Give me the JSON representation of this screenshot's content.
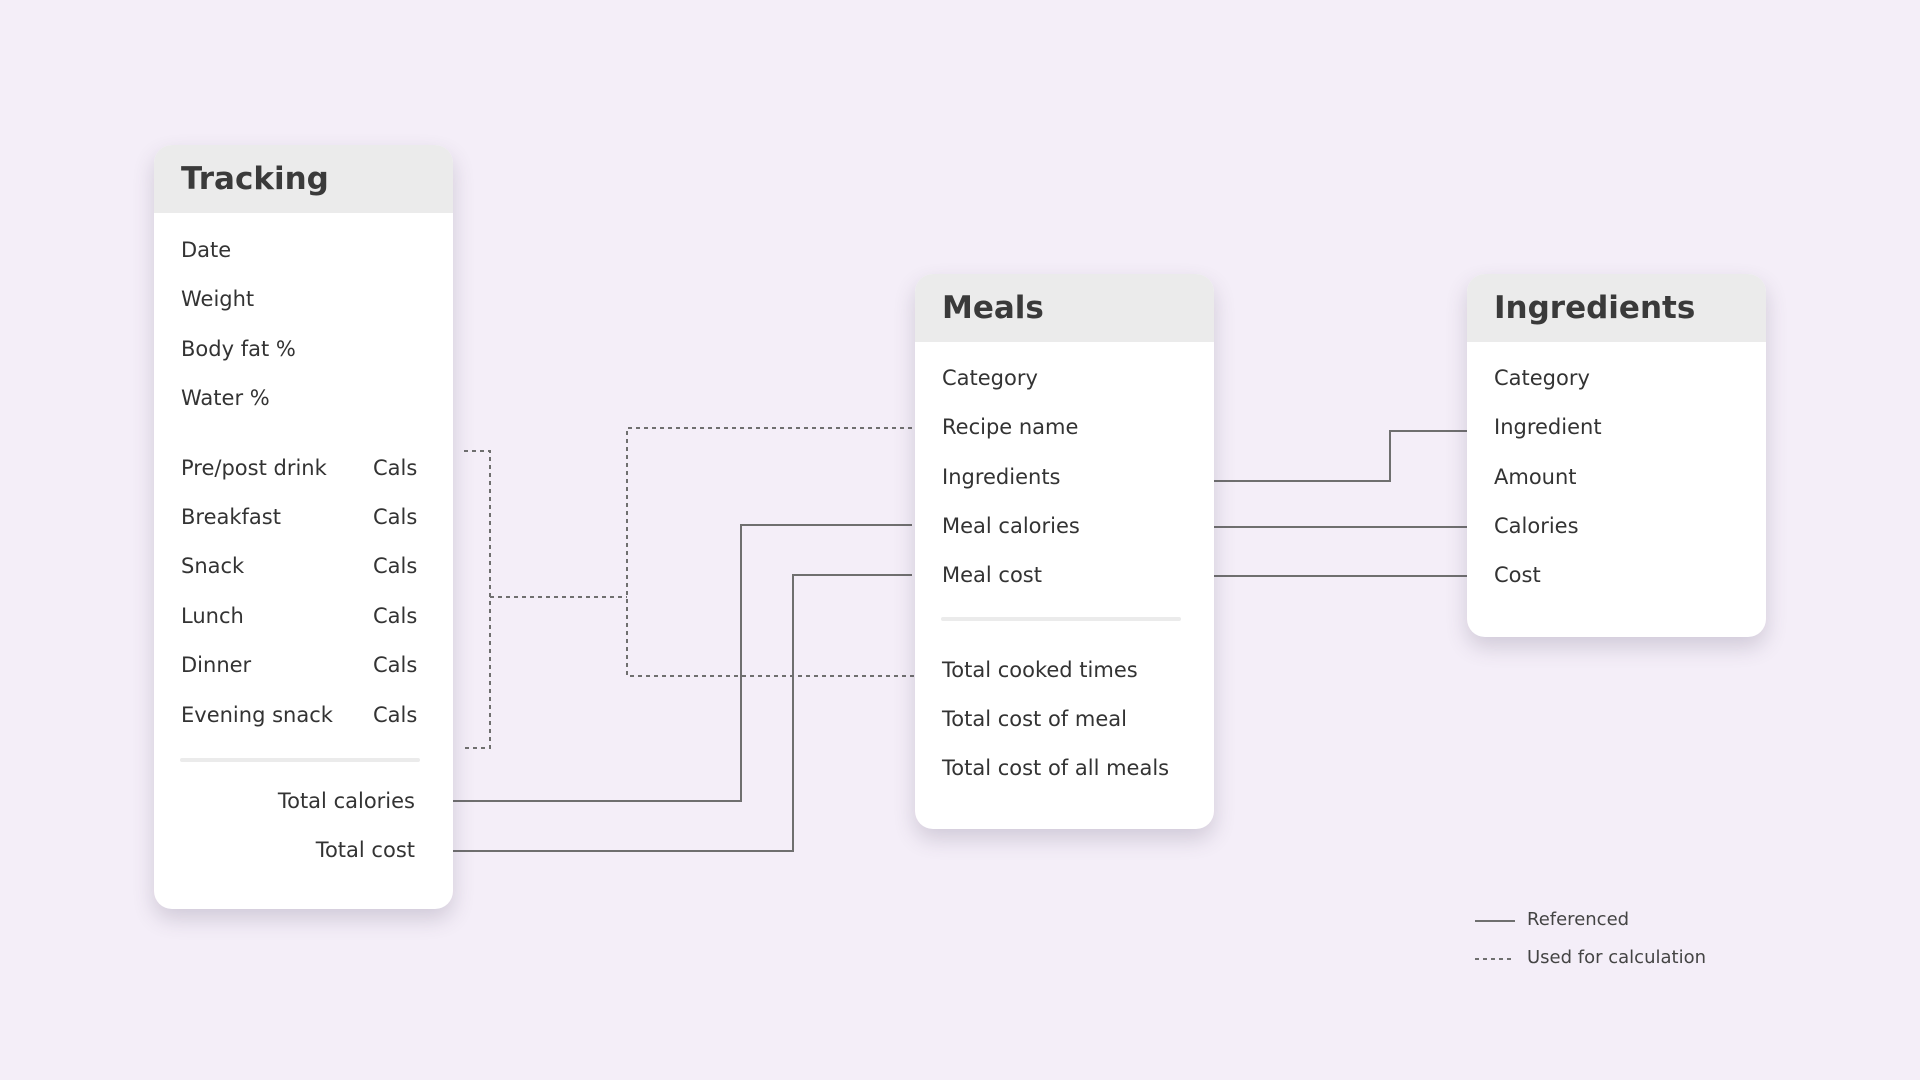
{
  "tracking": {
    "title": "Tracking",
    "fields": [
      "Date",
      "Weight",
      "Body fat %",
      "Water %"
    ],
    "meals": [
      {
        "label": "Pre/post drink",
        "unit": "Cals"
      },
      {
        "label": "Breakfast",
        "unit": "Cals"
      },
      {
        "label": "Snack",
        "unit": "Cals"
      },
      {
        "label": "Lunch",
        "unit": "Cals"
      },
      {
        "label": "Dinner",
        "unit": "Cals"
      },
      {
        "label": "Evening snack",
        "unit": "Cals"
      }
    ],
    "totals": [
      "Total calories",
      "Total cost"
    ]
  },
  "meals": {
    "title": "Meals",
    "fields": [
      "Category",
      "Recipe name",
      "Ingredients",
      "Meal calories",
      "Meal cost"
    ],
    "totals": [
      "Total cooked times",
      "Total cost of meal",
      "Total cost of all meals"
    ]
  },
  "ingredients": {
    "title": "Ingredients",
    "fields": [
      "Category",
      "Ingredient",
      "Amount",
      "Calories",
      "Cost"
    ]
  },
  "legend": {
    "referenced": "Referenced",
    "calculation": "Used for calculation"
  },
  "colors": {
    "background": "#f4eef8",
    "card": "#ffffff",
    "header": "#ebebeb",
    "connector": "#6f6f6f"
  }
}
